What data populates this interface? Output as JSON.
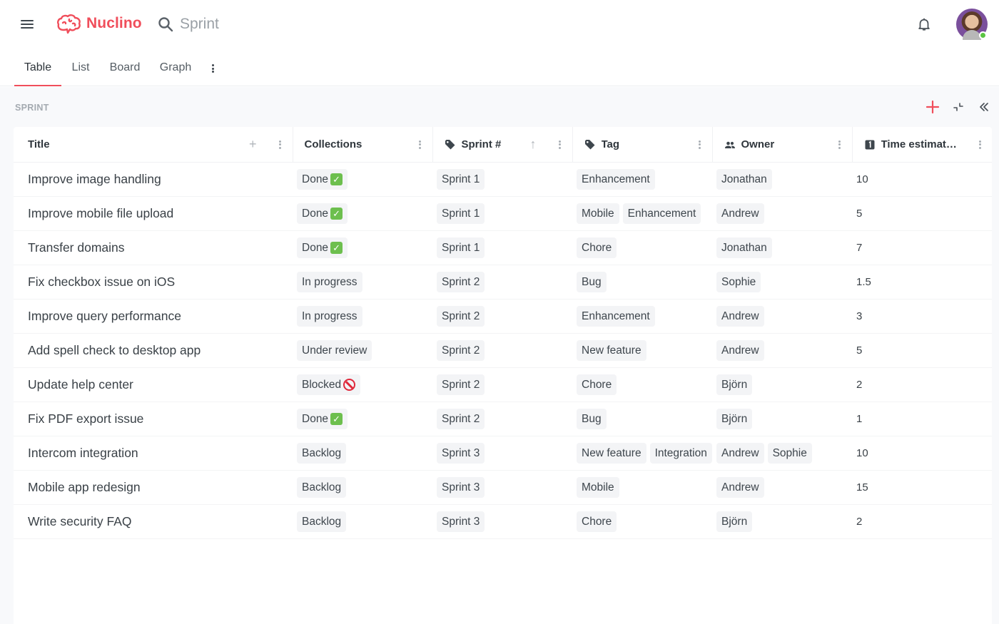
{
  "app": {
    "name": "Nuclino",
    "brand_color": "#f04e5b",
    "search_placeholder": "Sprint",
    "icons": {
      "menu": "menu-icon",
      "search": "search-icon",
      "notifications": "bell-icon",
      "avatar": "user-avatar",
      "presence": "online-status-dot"
    }
  },
  "tabs": [
    {
      "label": "Table",
      "active": true
    },
    {
      "label": "List",
      "active": false
    },
    {
      "label": "Board",
      "active": false
    },
    {
      "label": "Graph",
      "active": false
    }
  ],
  "section": {
    "label": "SPRINT",
    "actions": [
      "add-icon",
      "collapse-icon",
      "double-chevron-left-icon"
    ]
  },
  "table": {
    "columns": [
      {
        "key": "title",
        "label": "Title",
        "icon": null,
        "has_add": true
      },
      {
        "key": "collections",
        "label": "Collections",
        "icon": null
      },
      {
        "key": "sprint",
        "label": "Sprint #",
        "icon": "tag-icon",
        "sorted": "ascending"
      },
      {
        "key": "tag",
        "label": "Tag",
        "icon": "tag-icon"
      },
      {
        "key": "owner",
        "label": "Owner",
        "icon": "people-icon"
      },
      {
        "key": "time",
        "label": "Time estimat…",
        "icon": "number-icon"
      }
    ],
    "rows": [
      {
        "title": "Improve image handling",
        "collection": "Done",
        "collection_emoji": "check",
        "sprint": "Sprint 1",
        "tags": [
          "Enhancement"
        ],
        "owners": [
          "Jonathan"
        ],
        "time": "10"
      },
      {
        "title": "Improve mobile file upload",
        "collection": "Done",
        "collection_emoji": "check",
        "sprint": "Sprint 1",
        "tags": [
          "Mobile",
          "Enhancement"
        ],
        "owners": [
          "Andrew"
        ],
        "time": "5"
      },
      {
        "title": "Transfer domains",
        "collection": "Done",
        "collection_emoji": "check",
        "sprint": "Sprint 1",
        "tags": [
          "Chore"
        ],
        "owners": [
          "Jonathan"
        ],
        "time": "7"
      },
      {
        "title": "Fix checkbox issue on iOS",
        "collection": "In progress",
        "collection_emoji": null,
        "sprint": "Sprint 2",
        "tags": [
          "Bug"
        ],
        "owners": [
          "Sophie"
        ],
        "time": "1.5"
      },
      {
        "title": "Improve query performance",
        "collection": "In progress",
        "collection_emoji": null,
        "sprint": "Sprint 2",
        "tags": [
          "Enhancement"
        ],
        "owners": [
          "Andrew"
        ],
        "time": "3"
      },
      {
        "title": "Add spell check to desktop app",
        "collection": "Under review",
        "collection_emoji": null,
        "sprint": "Sprint 2",
        "tags": [
          "New feature"
        ],
        "owners": [
          "Andrew"
        ],
        "time": "5"
      },
      {
        "title": "Update help center",
        "collection": "Blocked",
        "collection_emoji": "blocked",
        "sprint": "Sprint 2",
        "tags": [
          "Chore"
        ],
        "owners": [
          "Björn"
        ],
        "time": "2"
      },
      {
        "title": "Fix PDF export issue",
        "collection": "Done",
        "collection_emoji": "check",
        "sprint": "Sprint 2",
        "tags": [
          "Bug"
        ],
        "owners": [
          "Björn"
        ],
        "time": "1"
      },
      {
        "title": "Intercom integration",
        "collection": "Backlog",
        "collection_emoji": null,
        "sprint": "Sprint 3",
        "tags": [
          "New feature",
          "Integration"
        ],
        "owners": [
          "Andrew",
          "Sophie"
        ],
        "time": "10"
      },
      {
        "title": "Mobile app redesign",
        "collection": "Backlog",
        "collection_emoji": null,
        "sprint": "Sprint 3",
        "tags": [
          "Mobile"
        ],
        "owners": [
          "Andrew"
        ],
        "time": "15"
      },
      {
        "title": "Write security FAQ",
        "collection": "Backlog",
        "collection_emoji": null,
        "sprint": "Sprint 3",
        "tags": [
          "Chore"
        ],
        "owners": [
          "Björn"
        ],
        "time": "2"
      }
    ]
  }
}
